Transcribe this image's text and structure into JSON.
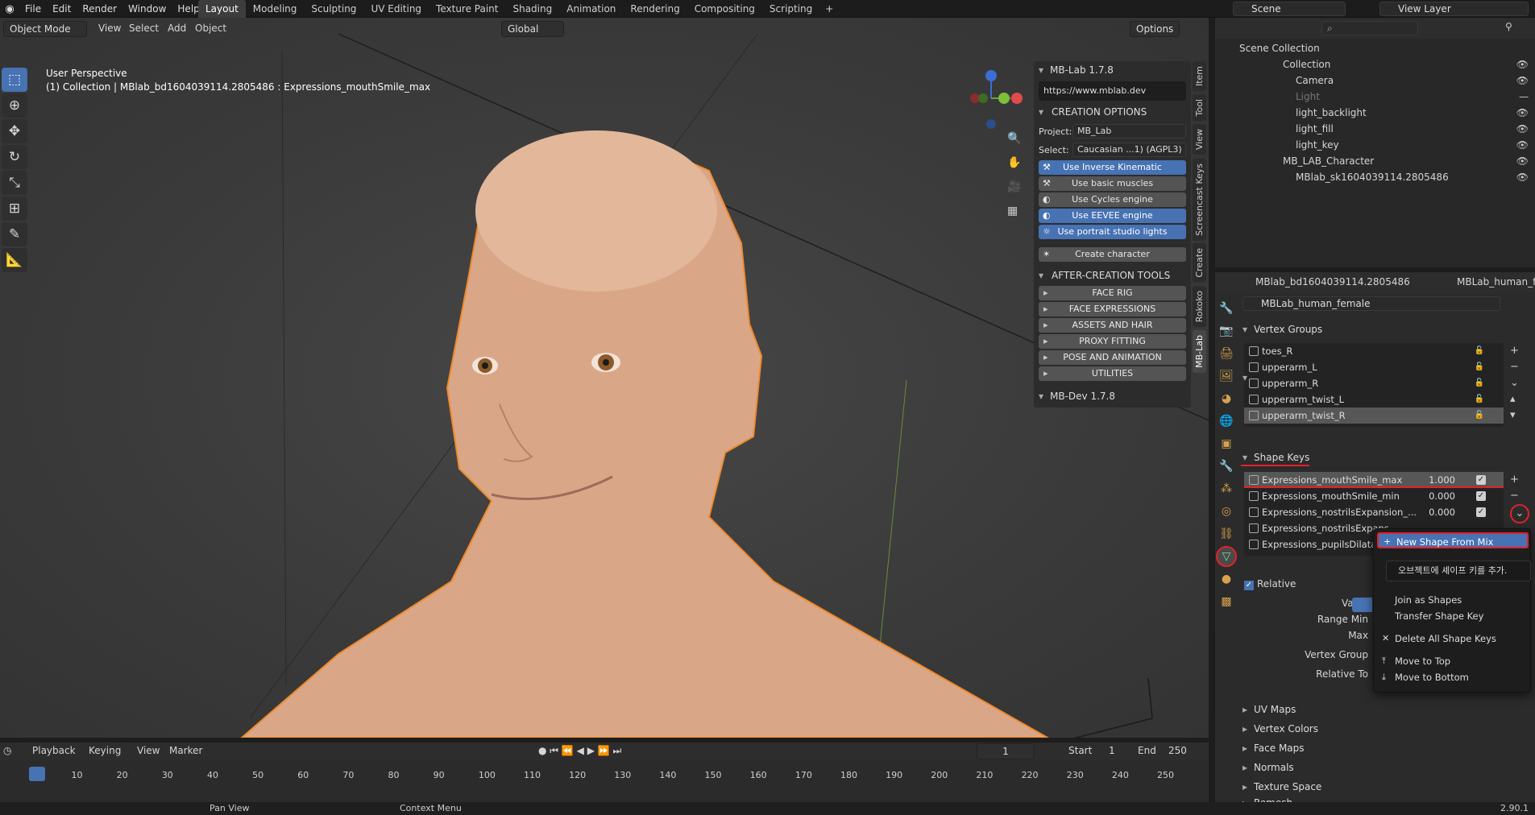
{
  "menu": {
    "items": [
      "File",
      "Edit",
      "Render",
      "Window",
      "Help"
    ]
  },
  "workspaces": {
    "tabs": [
      "Layout",
      "Modeling",
      "Sculpting",
      "UV Editing",
      "Texture Paint",
      "Shading",
      "Animation",
      "Rendering",
      "Compositing",
      "Scripting"
    ],
    "plus": "+"
  },
  "scene": {
    "scene_name": "Scene",
    "view_layer": "View Layer"
  },
  "viewport": {
    "mode": "Object Mode",
    "menus": [
      "View",
      "Select",
      "Add",
      "Object"
    ],
    "transform": "Global",
    "options": "Options",
    "perspective": "User Perspective",
    "collection_info": "(1) Collection | MBlab_bd1604039114.2805486 : Expressions_mouthSmile_max"
  },
  "mblab": {
    "title": "MB-Lab 1.7.8",
    "url": "https://www.mblab.dev",
    "creation_options": "CREATION OPTIONS",
    "project_label": "Project:",
    "project_value": "MB_Lab",
    "select_label": "Select:",
    "select_value": "Caucasian ...1) (AGPL3)",
    "toggles": [
      {
        "label": "Use Inverse Kinematic",
        "on": true
      },
      {
        "label": "Use basic muscles",
        "on": false
      },
      {
        "label": "Use Cycles engine",
        "on": false
      },
      {
        "label": "Use EEVEE engine",
        "on": true
      },
      {
        "label": "Use portrait studio lights",
        "on": true
      }
    ],
    "create_button": "Create character",
    "after_creation": "AFTER-CREATION TOOLS",
    "tools": [
      "FACE RIG",
      "FACE EXPRESSIONS",
      "ASSETS AND HAIR",
      "PROXY FITTING",
      "POSE AND ANIMATION",
      "UTILITIES"
    ],
    "mbdev": "MB-Dev 1.7.8"
  },
  "sidetabs": [
    "Item",
    "Tool",
    "View",
    "Screencast Keys",
    "Create",
    "Rokoko",
    "MB-Lab"
  ],
  "outliner": {
    "root": "Scene Collection",
    "rows": [
      {
        "label": "Collection",
        "indent": 1
      },
      {
        "label": "Camera",
        "indent": 2
      },
      {
        "label": "Light",
        "indent": 2,
        "dim": true
      },
      {
        "label": "light_backlight",
        "indent": 2
      },
      {
        "label": "light_fill",
        "indent": 2
      },
      {
        "label": "light_key",
        "indent": 2
      },
      {
        "label": "MB_LAB_Character",
        "indent": 1
      },
      {
        "label": "MBlab_sk1604039114.2805486",
        "indent": 2
      }
    ]
  },
  "properties": {
    "object_name": "MBlab_bd1604039114.2805486",
    "mesh_name": "MBLab_human_female",
    "data_field": "MBLab_human_female",
    "vertex_groups_title": "Vertex Groups",
    "vertex_groups": [
      "toes_R",
      "upperarm_L",
      "upperarm_R",
      "upperarm_twist_L",
      "upperarm_twist_R"
    ],
    "shape_keys_title": "Shape Keys",
    "shape_keys": [
      {
        "name": "Expressions_mouthSmile_max",
        "value": "1.000"
      },
      {
        "name": "Expressions_mouthSmile_min",
        "value": "0.000"
      },
      {
        "name": "Expressions_nostrilsExpansion_...",
        "value": "0.000"
      },
      {
        "name": "Expressions_nostrilsExpans",
        "value": ""
      },
      {
        "name": "Expressions_pupilsDilatatio",
        "value": ""
      }
    ],
    "relative": "Relative",
    "value_label": "Value",
    "range_min": "Range Min",
    "max": "Max",
    "vertex_group": "Vertex Group",
    "relative_to": "Relative To",
    "sections": [
      "UV Maps",
      "Vertex Colors",
      "Face Maps",
      "Normals",
      "Texture Space",
      "Remesh"
    ]
  },
  "context_menu": {
    "items": [
      "New Shape From Mix",
      "Join as Shapes",
      "Transfer Shape Key",
      "Delete All Shape Keys",
      "Move to Top",
      "Move to Bottom"
    ],
    "tooltip": "오브젝트에 셰이프 키를 추가."
  },
  "timeline": {
    "menus": [
      "Playback",
      "Keying",
      "View",
      "Marker"
    ],
    "current": "1",
    "start_label": "Start",
    "start": "1",
    "end_label": "End",
    "end": "250",
    "frames": [
      "1",
      "10",
      "20",
      "30",
      "40",
      "50",
      "60",
      "70",
      "80",
      "90",
      "100",
      "110",
      "120",
      "130",
      "140",
      "150",
      "160",
      "170",
      "180",
      "190",
      "200",
      "210",
      "220",
      "230",
      "240",
      "250"
    ]
  },
  "status": {
    "pan": "Pan View",
    "context": "Context Menu",
    "version": "2.90.1"
  },
  "colors": {
    "accent": "#4772b3",
    "highlight_red": "#e3212a"
  }
}
